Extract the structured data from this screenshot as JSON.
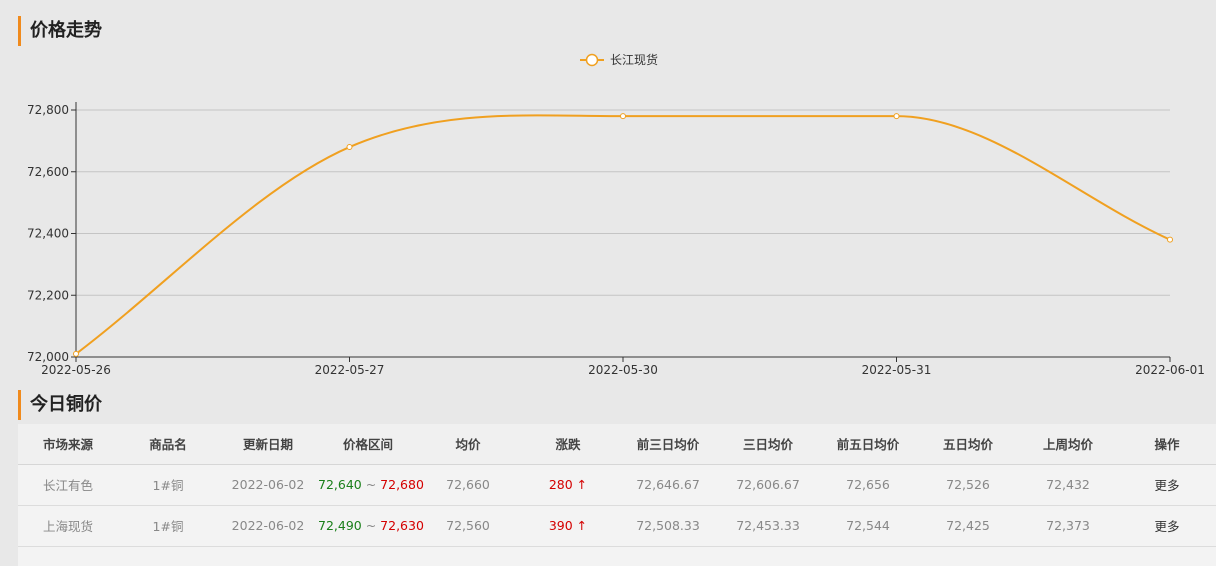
{
  "sections": {
    "trend_title": "价格走势",
    "today_title": "今日铜价"
  },
  "chart_data": {
    "type": "line",
    "categories": [
      "2022-05-26",
      "2022-05-27",
      "2022-05-30",
      "2022-05-31",
      "2022-06-01"
    ],
    "series": [
      {
        "name": "长江现货",
        "values": [
          72010,
          72680,
          72780,
          72780,
          72380
        ],
        "color": "#f0a020"
      }
    ],
    "yticks": [
      72000,
      72200,
      72400,
      72600,
      72800
    ],
    "ytick_labels": [
      "72,000",
      "72,200",
      "72,400",
      "72,600",
      "72,800"
    ],
    "ylim": [
      72000,
      72800
    ],
    "grid": true,
    "legend": "top-center",
    "smooth": true
  },
  "table": {
    "headers": [
      "市场来源",
      "商品名",
      "更新日期",
      "价格区间",
      "均价",
      "涨跌",
      "前三日均价",
      "三日均价",
      "前五日均价",
      "五日均价",
      "上周均价",
      "操作"
    ],
    "rows": [
      {
        "source": "长江有色",
        "product": "1#铜",
        "date": "2022-06-02",
        "low": "72,640",
        "sep": " ~ ",
        "high": "72,680",
        "avg": "72,660",
        "change": "280 ↑",
        "prev3": "72,646.67",
        "avg3": "72,606.67",
        "prev5": "72,656",
        "avg5": "72,526",
        "lastweek": "72,432",
        "action": "更多"
      },
      {
        "source": "上海现货",
        "product": "1#铜",
        "date": "2022-06-02",
        "low": "72,490",
        "sep": " ~ ",
        "high": "72,630",
        "avg": "72,560",
        "change": "390 ↑",
        "prev3": "72,508.33",
        "avg3": "72,453.33",
        "prev5": "72,544",
        "avg5": "72,425",
        "lastweek": "72,373",
        "action": "更多"
      }
    ]
  }
}
